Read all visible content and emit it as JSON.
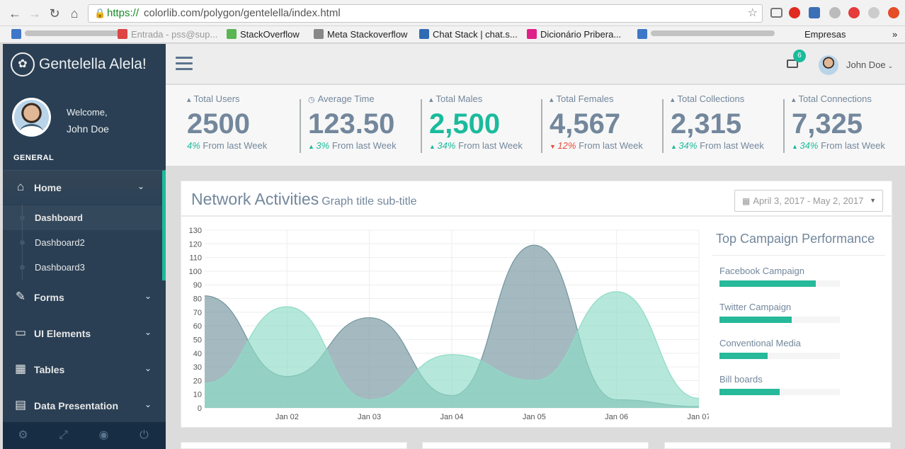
{
  "browser": {
    "url_scheme": "https://",
    "url_rest": "colorlib.com/polygon/gentelella/index.html",
    "bookmarks": [
      "StackOverflow",
      "Meta Stackoverflow",
      "Chat Stack | chat.s...",
      "Dicionário Pribera...",
      "Empresas"
    ],
    "blurred_bookmark_1": "Entrada - pss@sup...",
    "more": "»"
  },
  "sidebar": {
    "brand": "Gentelella Alela!",
    "welcome": "Welcome,",
    "username": "John Doe",
    "section": "GENERAL",
    "home": {
      "label": "Home",
      "icon": "home-icon"
    },
    "subitems": [
      "Dashboard",
      "Dashboard2",
      "Dashboard3"
    ],
    "menu": [
      {
        "label": "Forms",
        "icon": "edit-icon"
      },
      {
        "label": "UI Elements",
        "icon": "desktop-icon"
      },
      {
        "label": "Tables",
        "icon": "table-icon"
      },
      {
        "label": "Data Presentation",
        "icon": "bar-chart-icon"
      }
    ],
    "footer": [
      "settings-icon",
      "fullscreen-icon",
      "lock-icon",
      "logout-icon"
    ]
  },
  "topnav": {
    "mail_count": "6",
    "user": "John Doe"
  },
  "tiles": [
    {
      "title": "Total Users",
      "icon": "user-icon",
      "count": "2500",
      "pct": "4%",
      "trend": "none",
      "suffix": "From last Week"
    },
    {
      "title": "Average Time",
      "icon": "clock-icon",
      "count": "123.50",
      "pct": "3%",
      "trend": "up",
      "suffix": "From last Week"
    },
    {
      "title": "Total Males",
      "icon": "user-icon",
      "count": "2,500",
      "pct": "34%",
      "trend": "up",
      "suffix": "From last Week",
      "highlight": true
    },
    {
      "title": "Total Females",
      "icon": "user-icon",
      "count": "4,567",
      "pct": "12%",
      "trend": "down",
      "suffix": "From last Week"
    },
    {
      "title": "Total Collections",
      "icon": "user-icon",
      "count": "2,315",
      "pct": "34%",
      "trend": "up",
      "suffix": "From last Week"
    },
    {
      "title": "Total Connections",
      "icon": "user-icon",
      "count": "7,325",
      "pct": "34%",
      "trend": "up",
      "suffix": "From last Week"
    }
  ],
  "graph": {
    "title": "Network Activities",
    "subtitle": "Graph title sub-title",
    "date_range": "April 3, 2017 - May 2, 2017"
  },
  "chart_data": {
    "type": "area",
    "x": [
      "",
      "Jan 02",
      "Jan 03",
      "Jan 04",
      "Jan 05",
      "Jan 06",
      "Jan 07"
    ],
    "ylim": [
      0,
      130
    ],
    "yticks": [
      0,
      10,
      20,
      30,
      40,
      50,
      60,
      70,
      80,
      90,
      100,
      110,
      120,
      130
    ],
    "grid": true,
    "series": [
      {
        "values": [
          82,
          23,
          66,
          9,
          119,
          6,
          1
        ],
        "color": "#73959E"
      },
      {
        "values": [
          18,
          74,
          6,
          39,
          20,
          85,
          7
        ],
        "color": "#8EDBC6"
      }
    ]
  },
  "campaigns": {
    "title": "Top Campaign Performance",
    "items": [
      {
        "label": "Facebook Campaign",
        "value": 80
      },
      {
        "label": "Twitter Campaign",
        "value": 60
      },
      {
        "label": "Conventional Media",
        "value": 40
      },
      {
        "label": "Bill boards",
        "value": 50
      }
    ]
  },
  "colors": {
    "sidebar": "#2A3F54",
    "accent": "#1ABB9C",
    "text": "#73879C",
    "down": "#E74C3C"
  }
}
